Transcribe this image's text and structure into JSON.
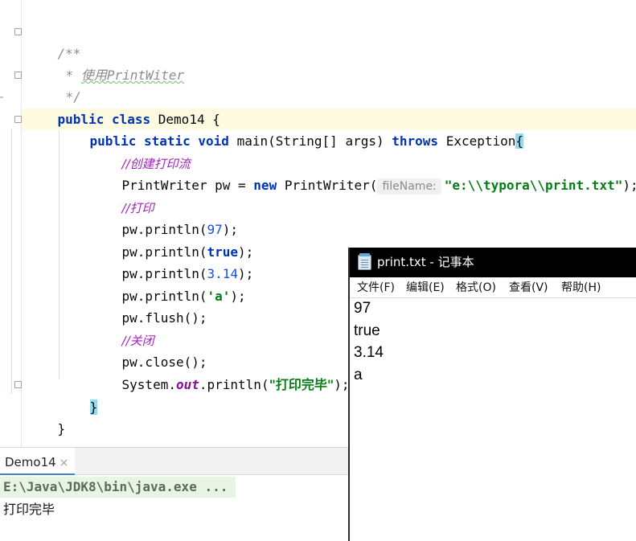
{
  "editor": {
    "lines": {
      "javadoc_open": "/**",
      "javadoc_star": "*",
      "javadoc_desc": "使用PrintWiter",
      "javadoc_close": "*/",
      "kw_public": "public",
      "kw_class": "class",
      "class_name": "Demo14",
      "open_brace": "{",
      "kw_static": "static",
      "kw_void": "void",
      "main_sig": "main(String[] args)",
      "kw_throws": "throws",
      "exception": "Exception",
      "comment_create": "//创建打印流",
      "pw_decl_start": "PrintWriter pw = ",
      "kw_new": "new",
      "pw_ctor": "PrintWriter(",
      "param_hint": "fileName:",
      "file_path": "\"e:\\\\typora\\\\print.txt\"",
      "stmt_end": ");",
      "comment_print": "//打印",
      "println_call": "pw.println(",
      "val_97": "97",
      "val_true": "true",
      "val_314": "3.14",
      "val_a": "'a'",
      "flush_stmt": "pw.flush();",
      "comment_close": "//关闭",
      "close_stmt": "pw.close();",
      "sys_prefix": "System.",
      "sys_out": "out",
      "sys_println": ".println(",
      "done_str": "\"打印完毕\"",
      "close_brace": "}"
    }
  },
  "run_panel": {
    "tab_label": "Demo14",
    "tab_close": "×",
    "command": "E:\\Java\\JDK8\\bin\\java.exe ...",
    "output": "打印完毕"
  },
  "notepad": {
    "title": "print.txt - 记事本",
    "menu": [
      "文件(F)",
      "编辑(E)",
      "格式(O)",
      "查看(V)",
      "帮助(H)"
    ],
    "content": [
      "97",
      "true",
      "3.14",
      "a"
    ]
  },
  "colors": {
    "keyword": "#0033b3",
    "string": "#067d17",
    "number": "#1750eb",
    "comment": "#a020c0",
    "caret_line": "#fcfae1"
  }
}
